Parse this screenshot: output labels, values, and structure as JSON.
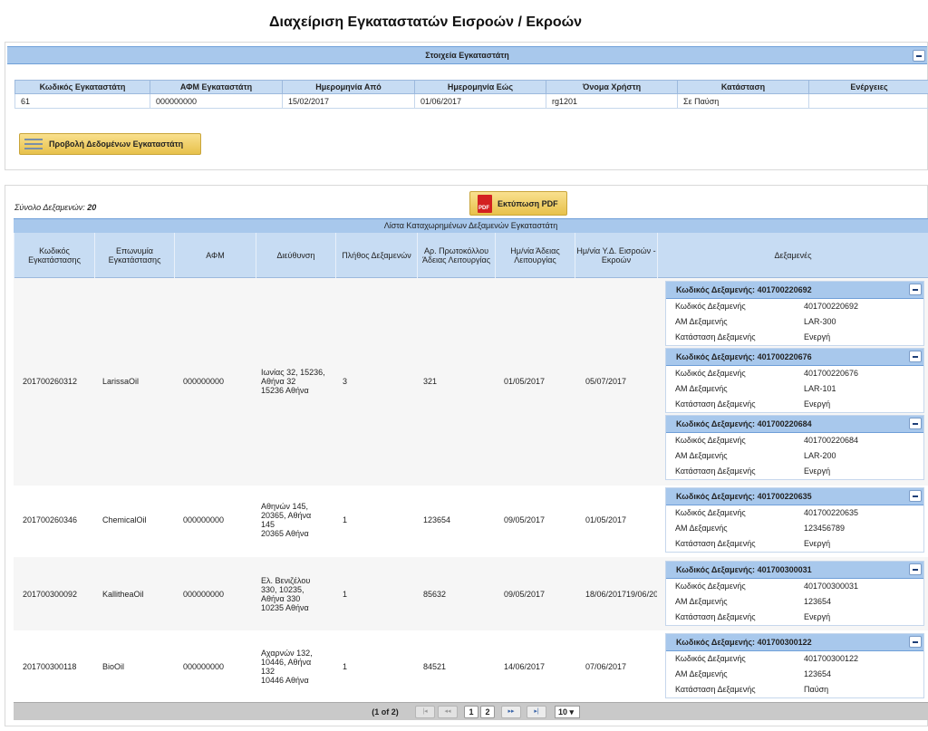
{
  "page_title": "Διαχείριση Εγκαταστατών Εισροών / Εκροών",
  "installer_panel": {
    "title": "Στοιχεία Εγκαταστάτη",
    "columns": [
      "Κωδικός Εγκαταστάτη",
      "ΑΦΜ Εγκαταστάτη",
      "Ημερομηνία Από",
      "Ημερομηνία Εώς",
      "Όνομα Χρήστη",
      "Κατάσταση",
      "Ενέργειες"
    ],
    "row": [
      "61",
      "000000000",
      "15/02/2017",
      "01/06/2017",
      "rg1201",
      "Σε Παύση",
      ""
    ],
    "view_button": "Προβολή Δεδομένων Εγκαταστάτη"
  },
  "summary": {
    "label": "Σύνολο Δεξαμενών:",
    "value": "20"
  },
  "pdf_button": {
    "label": "Εκτύπωση PDF",
    "icon_text": "PDF"
  },
  "list": {
    "title": "Λίστα Καταχωρημένων Δεξαμενών Εγκαταστάτη",
    "headers": [
      "Κωδικός Εγκατάστασης",
      "Επωνυμία Εγκατάστασης",
      "ΑΦΜ",
      "Διεύθυνση",
      "Πλήθος Δεξαμενών",
      "Αρ. Πρωτοκόλλου Άδειας Λειτουργίας",
      "Ημ/νία Άδειας Λειτουργίας",
      "Ημ/νία Υ.Δ. Εισροών - Εκροών",
      "Δεξαμενές"
    ],
    "tank_labels": {
      "header_prefix": "Κωδικός Δεξαμενής:",
      "code": "Κωδικός Δεξαμενής",
      "am": "ΑΜ Δεξαμενής",
      "status": "Κατάσταση Δεξαμενής"
    },
    "rows": [
      {
        "code": "201700260312",
        "name": "LarissaOil",
        "afm": "000000000",
        "address": [
          "Ιωνίας 32, 15236,",
          "Αθήνα 32",
          "15236 Αθήνα"
        ],
        "tanks_count": "3",
        "protocol": "321",
        "license_date": "01/05/2017",
        "yd_date": "05/07/2017",
        "tanks": [
          {
            "header": "401700220692",
            "code": "401700220692",
            "am": "LAR-300",
            "status": "Ενεργή"
          },
          {
            "header": "401700220676",
            "code": "401700220676",
            "am": "LAR-101",
            "status": "Ενεργή"
          },
          {
            "header": "401700220684",
            "code": "401700220684",
            "am": "LAR-200",
            "status": "Ενεργή"
          }
        ]
      },
      {
        "code": "201700260346",
        "name": "ChemicalOil",
        "afm": "000000000",
        "address": [
          "Αθηνών 145,",
          "20365, Αθήνα",
          "145",
          "20365 Αθήνα"
        ],
        "tanks_count": "1",
        "protocol": "123654",
        "license_date": "09/05/2017",
        "yd_date": "01/05/2017",
        "tanks": [
          {
            "header": "401700220635",
            "code": "401700220635",
            "am": "123456789",
            "status": "Ενεργή"
          }
        ]
      },
      {
        "code": "201700300092",
        "name": "KallitheaOil",
        "afm": "000000000",
        "address": [
          "Ελ. Βενιζέλου",
          "330, 10235,",
          "Αθήνα 330",
          "10235 Αθήνα"
        ],
        "tanks_count": "1",
        "protocol": "85632",
        "license_date": "09/05/2017",
        "yd_date": "18/06/201719/06/20",
        "tanks": [
          {
            "header": "401700300031",
            "code": "401700300031",
            "am": "123654",
            "status": "Ενεργή"
          }
        ]
      },
      {
        "code": "201700300118",
        "name": "BioOil",
        "afm": "000000000",
        "address": [
          "Αχαρνών 132,",
          "10446, Αθήνα",
          "132",
          "10446 Αθήνα"
        ],
        "tanks_count": "1",
        "protocol": "84521",
        "license_date": "14/06/2017",
        "yd_date": "07/06/2017",
        "tanks": [
          {
            "header": "401700300122",
            "code": "401700300122",
            "am": "123654",
            "status": "Παύση"
          }
        ]
      }
    ]
  },
  "pager": {
    "info": "(1 of 2)",
    "first": "|◂",
    "prev": "◂◂",
    "next": "▸▸",
    "last": "▸|",
    "pages": [
      "1",
      "2"
    ],
    "page_size": "10 ▾"
  },
  "colors": {
    "header_blue": "#a8c8ec",
    "col_header_blue": "#c7dcf3",
    "button_gold": "#e7c14b",
    "pdf_red": "#d32121"
  }
}
